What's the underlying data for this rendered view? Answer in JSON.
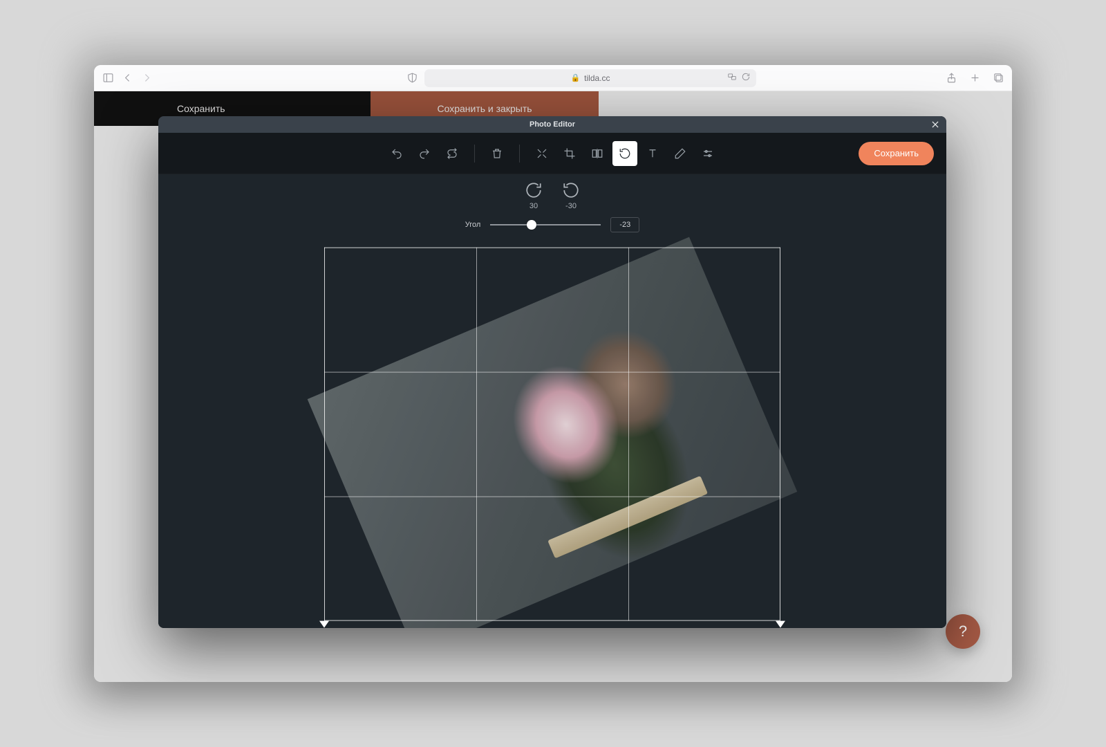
{
  "browser": {
    "url_host": "tilda.cc"
  },
  "page": {
    "save_label": "Сохранить",
    "save_close_label": "Сохранить и закрыть",
    "help_icon": "?"
  },
  "modal": {
    "title": "Photo Editor",
    "save_label": "Сохранить"
  },
  "rotate": {
    "cw_label": "30",
    "ccw_label": "-30",
    "angle_label": "Угол",
    "angle_value": "-23",
    "slider_min": -90,
    "slider_max": 90
  },
  "colors": {
    "accent": "#f0845c",
    "brand_brown": "#a0563e",
    "modal_bg": "#1e252b"
  }
}
